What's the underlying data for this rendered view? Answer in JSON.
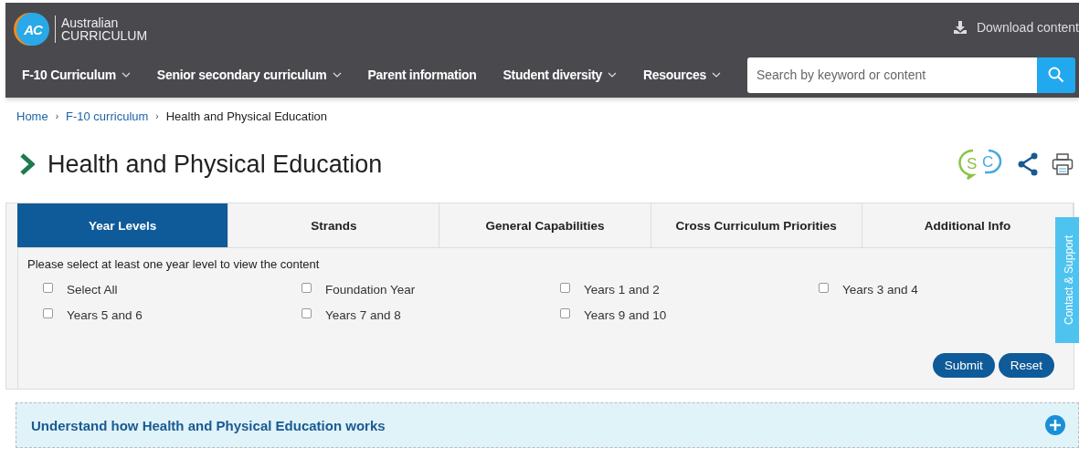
{
  "header": {
    "logo": {
      "mark": "AC",
      "line1": "Australian",
      "line2": "CURRICULUM"
    },
    "download": "Download content"
  },
  "nav": {
    "items": [
      {
        "label": "F-10 Curriculum",
        "dropdown": true
      },
      {
        "label": "Senior secondary curriculum",
        "dropdown": true
      },
      {
        "label": "Parent information",
        "dropdown": false
      },
      {
        "label": "Student diversity",
        "dropdown": true
      },
      {
        "label": "Resources",
        "dropdown": true
      }
    ],
    "search": {
      "placeholder": "Search by keyword or content"
    }
  },
  "breadcrumb_separator": "›",
  "breadcrumb": [
    {
      "label": "Home",
      "link": true
    },
    {
      "label": "F-10 curriculum",
      "link": true
    },
    {
      "label": "Health and Physical Education",
      "link": false
    }
  ],
  "page_title": "Health and Physical Education",
  "sc_badge": {
    "s": "S",
    "c": "C"
  },
  "tabs": [
    {
      "label": "Year Levels",
      "selected": true
    },
    {
      "label": "Strands",
      "selected": false
    },
    {
      "label": "General Capabilities",
      "selected": false
    },
    {
      "label": "Cross Curriculum Priorities",
      "selected": false
    },
    {
      "label": "Additional Info",
      "selected": false
    }
  ],
  "instruction": "Please select at least one year level to view the content",
  "year_options": [
    {
      "label": "Select All",
      "checked": false
    },
    {
      "label": "Foundation Year",
      "checked": false
    },
    {
      "label": "Years 1 and 2",
      "checked": false
    },
    {
      "label": "Years 3 and 4",
      "checked": false
    },
    {
      "label": "Years 5 and 6",
      "checked": false
    },
    {
      "label": "Years 7 and 8",
      "checked": false
    },
    {
      "label": "Years 9 and 10",
      "checked": false
    }
  ],
  "buttons": [
    "Submit",
    "Reset"
  ],
  "accordion": {
    "title": "Understand how Health and Physical Education works",
    "expanded": false
  },
  "side_tab": "Contact & Support"
}
